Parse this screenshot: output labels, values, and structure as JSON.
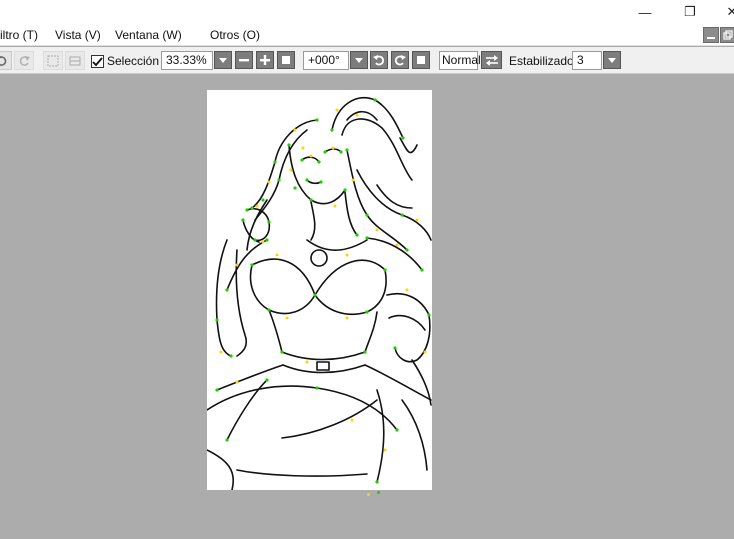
{
  "menu": {
    "items": [
      {
        "label": "iltro (T)"
      },
      {
        "label": "Vista (V)"
      },
      {
        "label": "Ventana (W)"
      },
      {
        "label": "Otros (O)"
      }
    ]
  },
  "window": {
    "minimize_glyph": "—",
    "restore_glyph": "❐",
    "close_glyph": "✕"
  },
  "toolbar": {
    "selection_label": "Selección",
    "selection_checked": true,
    "zoom_value": "33.33%",
    "rotation_value": "+000°",
    "blend_mode": "Normal",
    "stabilizer_label": "Estabilizador",
    "stabilizer_value": "3"
  },
  "colors": {
    "workspace": "#acacac",
    "vector_point_green": "#22cc00",
    "vector_point_yellow": "#ffd200",
    "line_art": "#111111"
  },
  "icons": [
    "undo-icon",
    "redo-icon",
    "selection-tool-icon",
    "transform-icon",
    "zoom-dropdown-icon",
    "zoom-out-icon",
    "zoom-in-icon",
    "zoom-reset-icon",
    "rotate-dropdown-icon",
    "rotate-left-icon",
    "rotate-right-icon",
    "rotate-reset-icon",
    "flip-horizontal-icon",
    "stabilizer-dropdown-icon"
  ]
}
